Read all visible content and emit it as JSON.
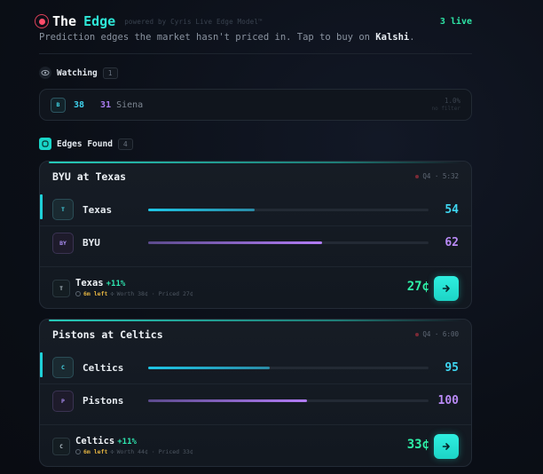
{
  "header": {
    "title_a": "The",
    "title_b": "Edge",
    "powered_by": "powered by Cyris Live Edge Model™",
    "live_count": "3 live",
    "subtitle_pre": "Prediction edges the market hasn't priced in. Tap to buy on ",
    "subtitle_brand": "Kalshi",
    "subtitle_post": "."
  },
  "watching": {
    "label": "Watching",
    "count": "1",
    "item": {
      "badge": "B",
      "score_a": "38",
      "score_b": "31",
      "team_b": "Siena",
      "edge": "1.0%",
      "note": "no filter"
    }
  },
  "edges_found": {
    "label": "Edges Found",
    "count": "4"
  },
  "cards": [
    {
      "title": "BYU at Texas",
      "meta": "Q4 · 5:32",
      "teams": [
        {
          "badge": "T",
          "name": "Texas",
          "pct": "54",
          "fill": 0.38,
          "color": "cyan",
          "accent": true
        },
        {
          "badge": "BY",
          "name": "BYU",
          "pct": "62",
          "fill": 0.62,
          "color": "purple",
          "accent": false
        }
      ],
      "foot": {
        "badge": "T",
        "team": "Texas",
        "edge": "+11%",
        "time_left": "6m left",
        "detail": "Worth 38¢ · Priced 27¢",
        "price": "27¢"
      }
    },
    {
      "title": "Pistons at Celtics",
      "meta": "Q4 · 6:00",
      "teams": [
        {
          "badge": "C",
          "name": "Celtics",
          "pct": "95",
          "fill": 0.435,
          "color": "cyan",
          "accent": true
        },
        {
          "badge": "P",
          "name": "Pistons",
          "pct": "100",
          "fill": 0.565,
          "color": "purple",
          "accent": false
        }
      ],
      "foot": {
        "badge": "C",
        "team": "Celtics",
        "edge": "+11%",
        "time_left": "6m left",
        "detail": "Worth 44¢ · Priced 33¢",
        "price": "33¢"
      }
    }
  ]
}
